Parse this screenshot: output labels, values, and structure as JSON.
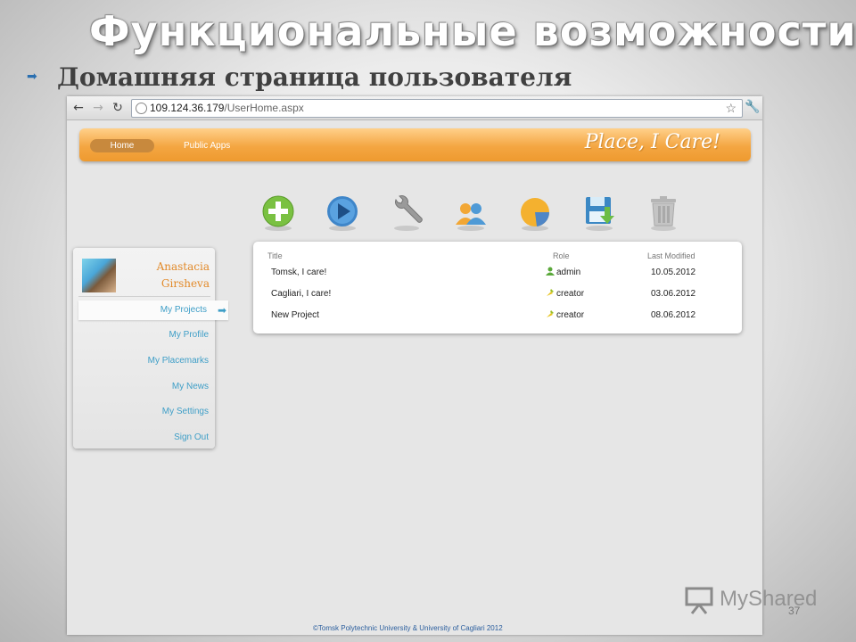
{
  "slide": {
    "title": "Функциональные возможности",
    "subtitle": "Домашняя страница пользователя",
    "page_number": "37"
  },
  "browser": {
    "url_host": "109.124.36.179",
    "url_path": "/UserHome.aspx"
  },
  "app": {
    "nav_home": "Home",
    "nav_public_apps": "Public Apps",
    "logo": "Place, I Care!",
    "footer": "©Tomsk Polytechnic University & University of Cagliari 2012",
    "colors": {
      "header": "#f4a642",
      "link": "#3e9ec7",
      "username": "#e28a2a"
    }
  },
  "actions": [
    {
      "icon": "add-icon"
    },
    {
      "icon": "play-icon"
    },
    {
      "icon": "wrench-icon"
    },
    {
      "icon": "users-icon"
    },
    {
      "icon": "pie-chart-icon"
    },
    {
      "icon": "save-download-icon"
    },
    {
      "icon": "trash-icon"
    }
  ],
  "user": {
    "first_name": "Anastacia",
    "last_name": "Girsheva",
    "menu": [
      "My Projects",
      "My Profile",
      "My Placemarks",
      "My News",
      "My Settings",
      "Sign Out"
    ],
    "active_menu_index": 0
  },
  "projects": {
    "headers": {
      "title": "Title",
      "role": "Role",
      "modified": "Last Modified"
    },
    "rows": [
      {
        "title": "Tomsk, I care!",
        "role": "admin",
        "role_icon": "admin-user-icon",
        "modified": "10.05.2012"
      },
      {
        "title": "Cagliari, I care!",
        "role": "creator",
        "role_icon": "creator-icon",
        "modified": "03.06.2012"
      },
      {
        "title": "New Project",
        "role": "creator",
        "role_icon": "creator-icon",
        "modified": "08.06.2012"
      }
    ]
  },
  "watermark": "MyShared"
}
